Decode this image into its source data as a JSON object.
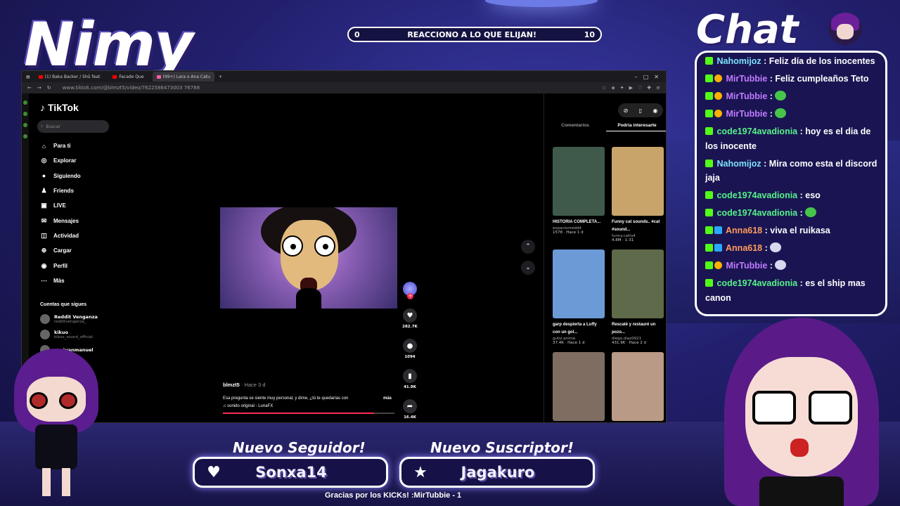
{
  "overlay": {
    "streamer_name": "Nimy",
    "goal": {
      "left": "0",
      "title": "REACCIONO A LO QUE ELIJAN!",
      "right": "10"
    },
    "chat_title": "Chat",
    "follower_label": "Nuevo Seguidor!",
    "follower_name": "Sonxa14",
    "subscriber_label": "Nuevo Suscriptor!",
    "subscriber_name": "Jagakuro",
    "thanks": "Gracias por los KICKs! :MirTubbie - 1"
  },
  "browser": {
    "tabs": [
      "(1) Baka Backer / Shū feat",
      "Facade Que",
      "(99+) Lara o Ana Catu"
    ],
    "url": "www.tiktok.com/@blmzt5/video/7622586473003 76788"
  },
  "tiktok": {
    "logo": "TikTok",
    "search_placeholder": "Buscar",
    "nav": [
      {
        "icon": "⌂",
        "label": "Para ti"
      },
      {
        "icon": "◎",
        "label": "Explorar"
      },
      {
        "icon": "●",
        "label": "Siguiendo"
      },
      {
        "icon": "♟",
        "label": "Friends"
      },
      {
        "icon": "▣",
        "label": "LIVE"
      },
      {
        "icon": "✉",
        "label": "Mensajes"
      },
      {
        "icon": "◫",
        "label": "Actividad"
      },
      {
        "icon": "⊕",
        "label": "Cargar"
      },
      {
        "icon": "◉",
        "label": "Perfil"
      },
      {
        "icon": "⋯",
        "label": "Más"
      }
    ],
    "following_header": "Cuentas que sigues",
    "following": [
      {
        "name": "Reddit Venganza",
        "handle": "redditvenganza_"
      },
      {
        "name": "kikuo",
        "handle": "kikuo_sound_official"
      },
      {
        "name": "ecojuanmanuel",
        "handle": ""
      }
    ],
    "video": {
      "author": "blmzt5",
      "time": "· Hace 3 d",
      "caption": "Esa pregunta se siente muy personal, y dime, ¿tú te quedarías con",
      "more": "más",
      "sound": "♫ sonido original - LunaFX",
      "progress": 0.88
    },
    "actions": [
      {
        "icon": "♥",
        "count": "282.7K"
      },
      {
        "icon": "●",
        "count": "1094"
      },
      {
        "icon": "▮",
        "count": "41.9K"
      },
      {
        "icon": "➦",
        "count": "16.4K"
      }
    ],
    "right_tabs": [
      "Comentarios",
      "Podría interesarte"
    ],
    "cards": [
      {
        "title": "HISTORIA COMPLETA...",
        "author": "expacionreddit",
        "meta": "1578 · Hace 1 d",
        "color": "#3f5a4a"
      },
      {
        "title": "Funny cat sounds.. #cat #sound...",
        "author": "funny.catts4",
        "meta": "4.8M · 1-31",
        "color": "#c9a46a"
      },
      {
        "title": "garp despierta a Luffy con un gol...",
        "author": "gutiz.anime",
        "meta": "37.4K · Hace 1 d",
        "color": "#6c9ad6"
      },
      {
        "title": "Rescaté y restauré un pozo...",
        "author": "diego.diaz0921",
        "meta": "431.9K · Hace 2 d",
        "color": "#5e6a4a"
      },
      {
        "title": "",
        "author": "",
        "meta": "",
        "color": "#7f6d62"
      },
      {
        "title": "",
        "author": "",
        "meta": "",
        "color": "#b89a87"
      }
    ]
  },
  "chat": [
    {
      "badges": [
        "k"
      ],
      "user": "Nahomijoz",
      "color": "#7de0ff",
      "text": ": Feliz día de los inocentes"
    },
    {
      "badges": [
        "k",
        "gold"
      ],
      "user": "MirTubbie",
      "color": "#c07aff",
      "text": ": Feliz cumpleaños Teto"
    },
    {
      "badges": [
        "k",
        "gold"
      ],
      "user": "MirTubbie",
      "color": "#c07aff",
      "text": ":",
      "emote": "green"
    },
    {
      "badges": [
        "k",
        "gold"
      ],
      "user": "MirTubbie",
      "color": "#c07aff",
      "text": ":",
      "emote": "green"
    },
    {
      "badges": [
        "k"
      ],
      "user": "code1974avadionia",
      "color": "#57f287",
      "text": ": hoy es el dia de los inocente"
    },
    {
      "badges": [
        "k"
      ],
      "user": "Nahomijoz",
      "color": "#7de0ff",
      "text": ": Mira como esta el discord jaja"
    },
    {
      "badges": [
        "k"
      ],
      "user": "code1974avadionia",
      "color": "#57f287",
      "text": ": eso"
    },
    {
      "badges": [
        "k"
      ],
      "user": "code1974avadionia",
      "color": "#57f287",
      "text": ":",
      "emote": "green"
    },
    {
      "badges": [
        "k",
        "blue"
      ],
      "user": "Anna618",
      "color": "#ff9a5c",
      "text": ": viva el ruikasa"
    },
    {
      "badges": [
        "k",
        "blue"
      ],
      "user": "Anna618",
      "color": "#ff9a5c",
      "text": ":",
      "emote": "white"
    },
    {
      "badges": [
        "k",
        "gold"
      ],
      "user": "MirTubbie",
      "color": "#c07aff",
      "text": ":",
      "emote": "white"
    },
    {
      "badges": [
        "k"
      ],
      "user": "code1974avadionia",
      "color": "#57f287",
      "text": ": es el ship mas canon"
    }
  ]
}
